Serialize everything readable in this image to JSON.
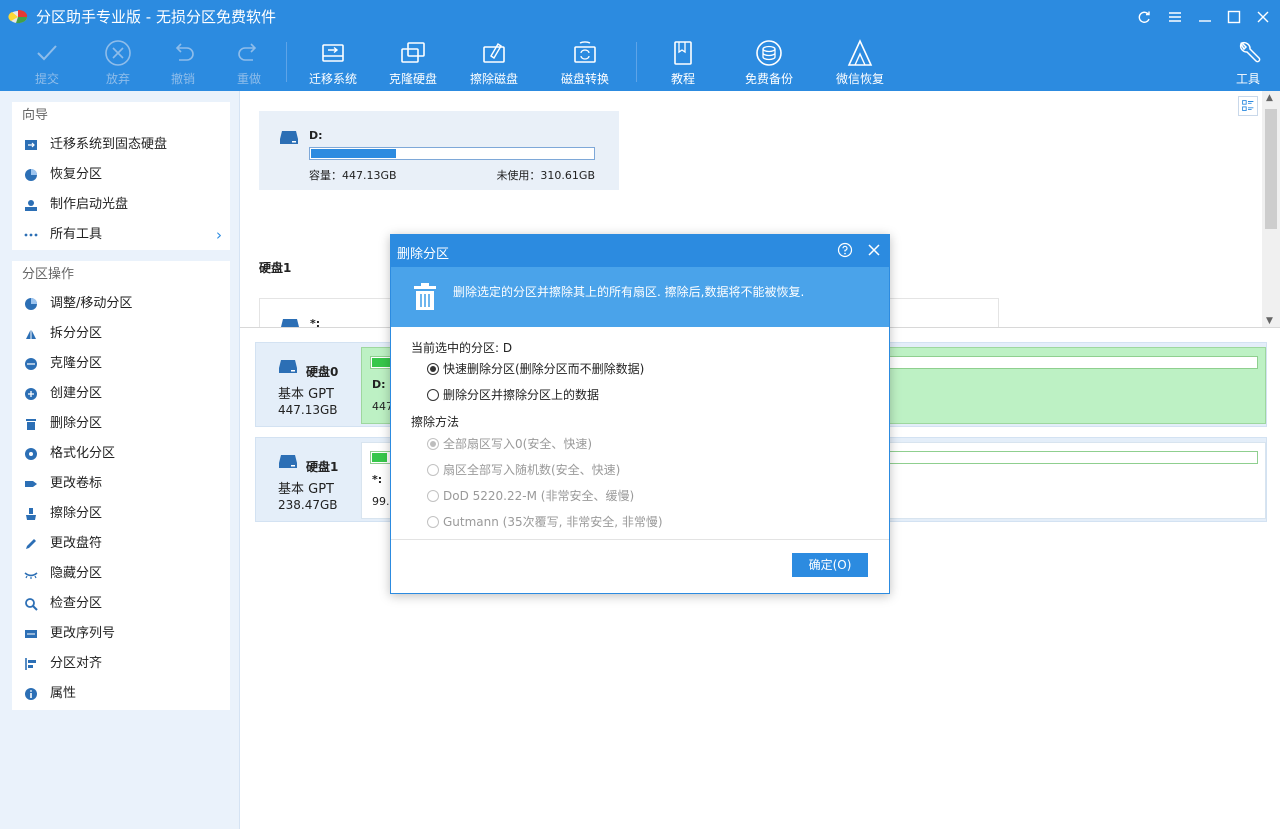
{
  "app": {
    "title": "分区助手专业版 - 无损分区免费软件"
  },
  "window_controls": {
    "refresh": "refresh-icon",
    "menu": "menu-icon",
    "minimize": "minimize-icon",
    "maximize": "maximize-icon",
    "close": "close-icon"
  },
  "toolbar": {
    "commit": "提交",
    "discard": "放弃",
    "undo": "撤销",
    "redo": "重做",
    "migrate": "迁移系统",
    "clone": "克隆硬盘",
    "wipe": "擦除磁盘",
    "convert": "磁盘转换",
    "tutorial": "教程",
    "backup": "免费备份",
    "wechat": "微信恢复",
    "tools": "工具"
  },
  "sidebar": {
    "wizard_title": "向导",
    "wizard_items": [
      {
        "label": "迁移系统到固态硬盘",
        "icon": "migrate-icon"
      },
      {
        "label": "恢复分区",
        "icon": "recover-icon"
      },
      {
        "label": "制作启动光盘",
        "icon": "boot-disc-icon"
      },
      {
        "label": "所有工具",
        "icon": "more-icon"
      }
    ],
    "ops_title": "分区操作",
    "ops_items": [
      {
        "label": "调整/移动分区",
        "icon": "resize-icon"
      },
      {
        "label": "拆分分区",
        "icon": "split-icon"
      },
      {
        "label": "克隆分区",
        "icon": "clone-icon"
      },
      {
        "label": "创建分区",
        "icon": "create-icon"
      },
      {
        "label": "删除分区",
        "icon": "trash-icon"
      },
      {
        "label": "格式化分区",
        "icon": "format-icon"
      },
      {
        "label": "更改卷标",
        "icon": "label-icon"
      },
      {
        "label": "擦除分区",
        "icon": "wipe-icon"
      },
      {
        "label": "更改盘符",
        "icon": "edit-icon"
      },
      {
        "label": "隐藏分区",
        "icon": "hide-icon"
      },
      {
        "label": "检查分区",
        "icon": "check-icon"
      },
      {
        "label": "更改序列号",
        "icon": "serial-icon"
      },
      {
        "label": "分区对齐",
        "icon": "align-icon"
      },
      {
        "label": "属性",
        "icon": "info-icon"
      }
    ]
  },
  "upper": {
    "volume": {
      "name": "D:",
      "usage_fraction": 0.3,
      "capacity": "容量：447.13GB",
      "free": "未使用：310.61GB"
    },
    "disk_label": "硬盘1",
    "partial_volume": "*:"
  },
  "disks": [
    {
      "name": "硬盘0",
      "type": "基本 GPT",
      "size": "447.13GB",
      "part_name": "D:",
      "part_size": "447.",
      "usage_fraction": 0.025
    },
    {
      "name": "硬盘1",
      "type": "基本 GPT",
      "size": "238.47GB",
      "part_name": "*:",
      "part_size": "99...",
      "usage_fraction": 0.017
    }
  ],
  "dialog": {
    "title": "删除分区",
    "banner": "删除选定的分区并擦除其上的所有扇区. 擦除后,数据将不能被恢复.",
    "current_label": "当前选中的分区: D",
    "options": [
      "快速删除分区(删除分区而不删除数据)",
      "删除分区并擦除分区上的数据"
    ],
    "wipe_method_label": "擦除方法",
    "wipe_methods": [
      "全部扇区写入0(安全、快速)",
      "扇区全部写入随机数(安全、快速)",
      "DoD 5220.22-M (非常安全、缓慢)",
      "Gutmann (35次覆写, 非常安全, 非常慢)"
    ],
    "ok": "确定(O)"
  },
  "colors": {
    "primary": "#2c8be0",
    "banner": "#4aa3ea",
    "partition_green": "#bdf1c4",
    "bar_green": "#37c74b"
  }
}
